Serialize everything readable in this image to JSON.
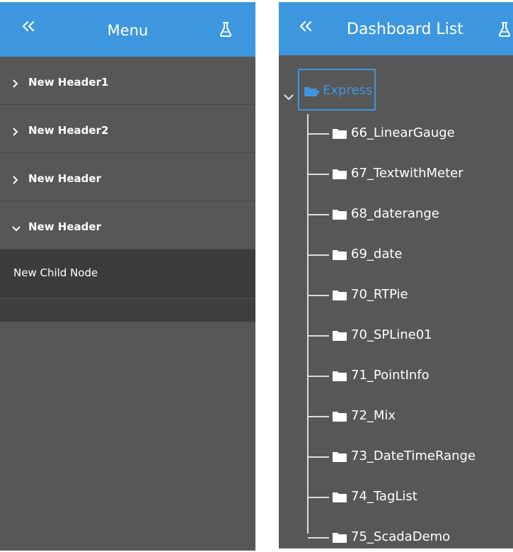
{
  "menu": {
    "title": "Menu",
    "collapse_icon": "double-chevron-left-icon",
    "action_icon": "flask-icon",
    "items": [
      {
        "label": "New Header1",
        "expanded": false
      },
      {
        "label": "New Header2",
        "expanded": false
      },
      {
        "label": "New Header",
        "expanded": false
      },
      {
        "label": "New Header",
        "expanded": true
      }
    ],
    "child": {
      "label": "New Child Node"
    }
  },
  "dashboard": {
    "title": "Dashboard List",
    "collapse_icon": "double-chevron-left-icon",
    "action_icon": "flask-icon",
    "root": {
      "label": "Express",
      "expanded": true,
      "icon": "folder-open-icon"
    },
    "items": [
      {
        "label": "66_LinearGauge"
      },
      {
        "label": "67_TextwithMeter"
      },
      {
        "label": "68_daterange"
      },
      {
        "label": "69_date"
      },
      {
        "label": "70_RTPie"
      },
      {
        "label": "70_SPLine01"
      },
      {
        "label": "71_PointInfo"
      },
      {
        "label": "72_Mix"
      },
      {
        "label": "73_DateTimeRange"
      },
      {
        "label": "74_TagList"
      },
      {
        "label": "75_ScadaDemo"
      }
    ]
  },
  "colors": {
    "accent": "#3d97df",
    "panel_bg": "#575757",
    "child_bg": "#3c3c3c",
    "text": "#ffffff",
    "tree_line": "#dcdcdc"
  }
}
